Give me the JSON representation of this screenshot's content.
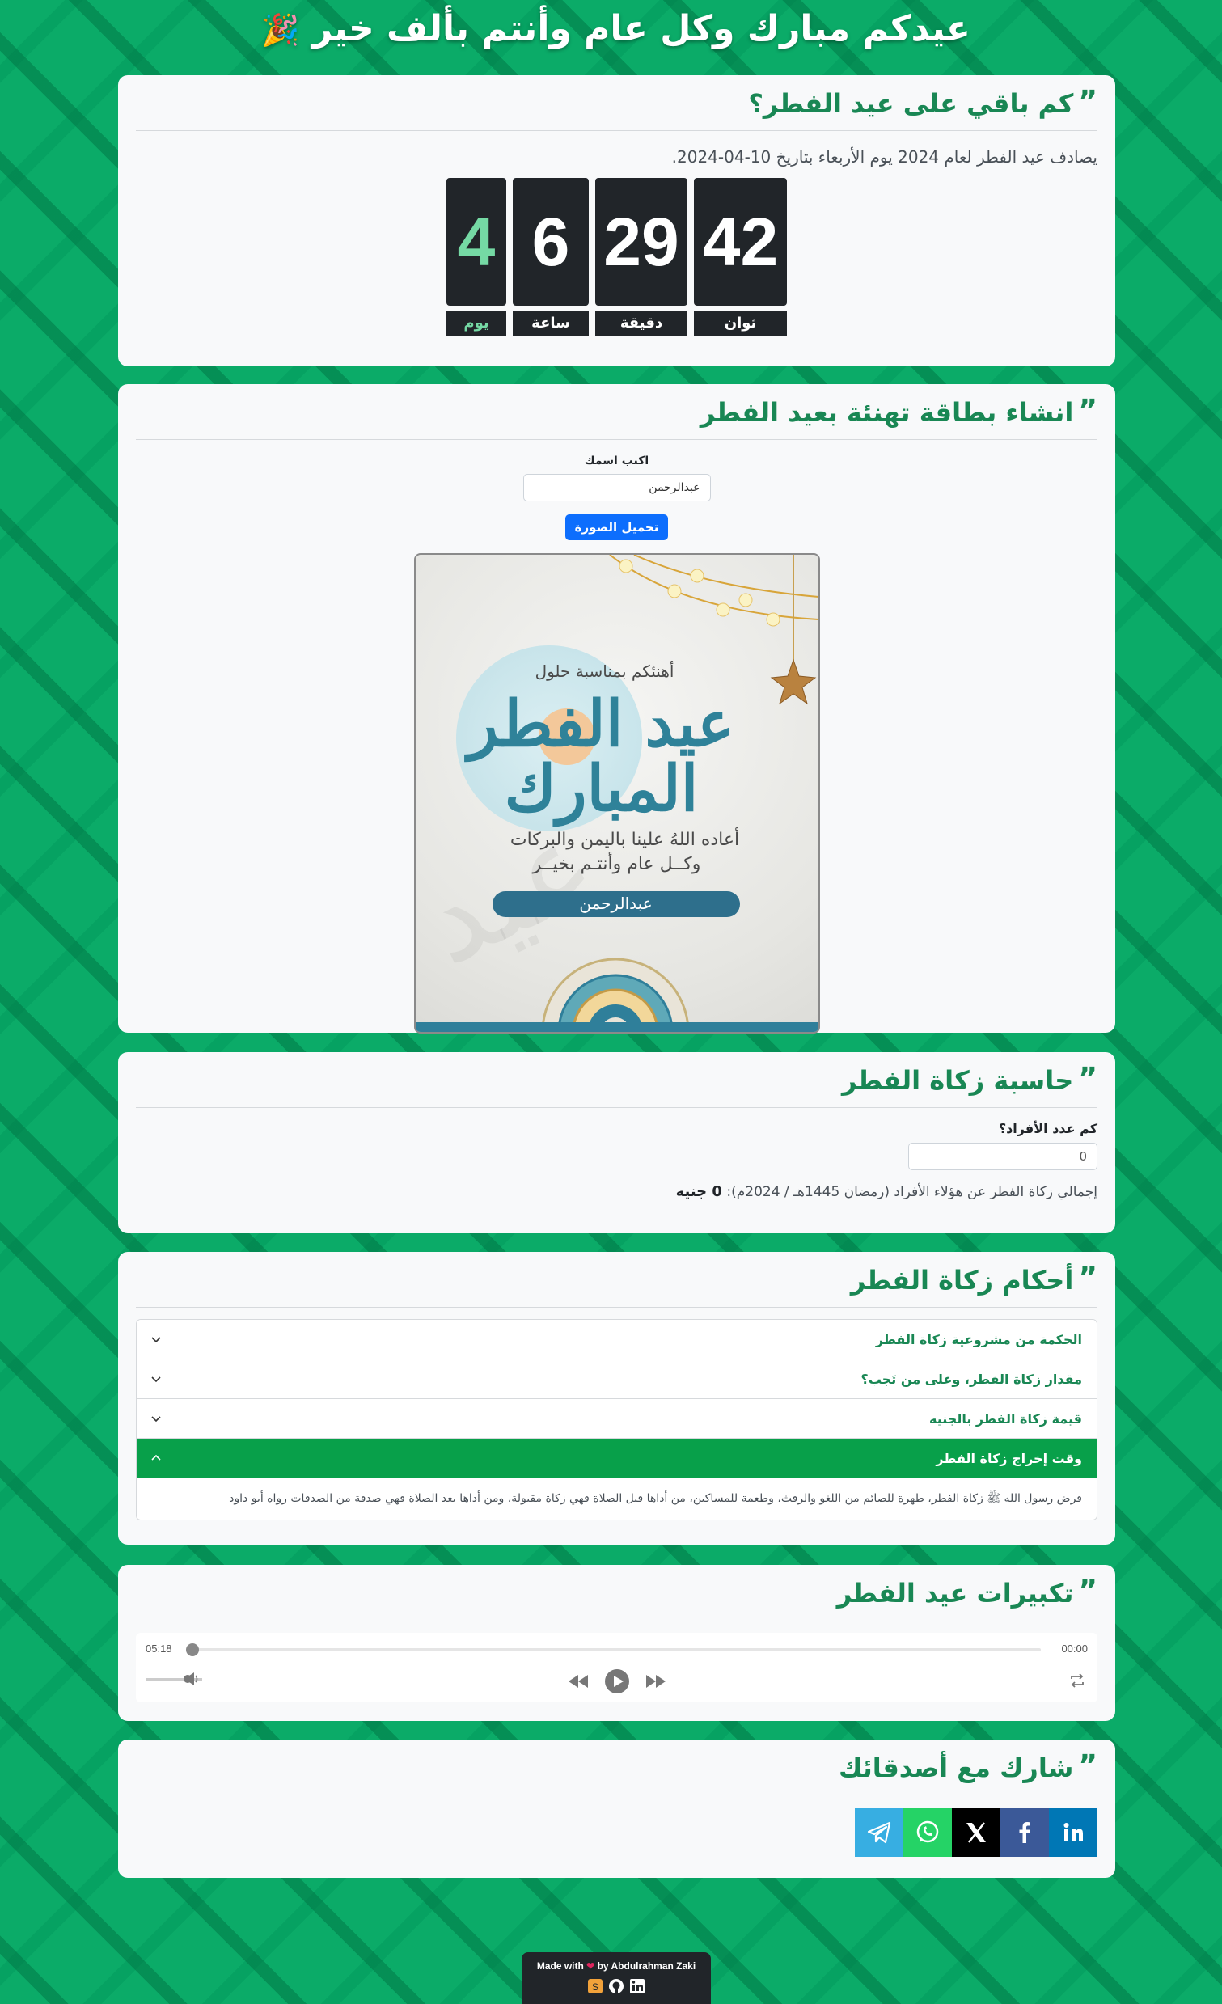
{
  "header": {
    "title": "عيدكم مبارك وكل عام وأنتم بألف خير",
    "emoji": "🎉"
  },
  "countdown": {
    "title": "كم باقي على عيد الفطر؟",
    "lead": "يصادف عيد الفطر لعام 2024 يوم الأربعاء بتاريخ 10-04-2024.",
    "days": "4",
    "days_label": "يوم",
    "hours": "6",
    "hours_label": "ساعة",
    "minutes": "29",
    "minutes_label": "دقيقة",
    "seconds": "42",
    "seconds_label": "ثوان"
  },
  "card_generator": {
    "title": "انشاء بطاقة تهنئة بعيد الفطر",
    "name_label": "اكتب اسمك",
    "name_value": "عبدالرحمن",
    "download_button": "تحميل الصورة",
    "card": {
      "intro": "أهنئكم بمناسبة حلول",
      "calligraphy": "عيد الفطر المبارك",
      "line1": "أعاده اللهُ علينا باليمن والبركات",
      "line2": "وكــل عام وأنتـم بخيــر",
      "name": "عبدالرحمن"
    }
  },
  "zakat_calc": {
    "title": "حاسبة زكاة الفطر",
    "question": "كم عدد الأفراد؟",
    "value": "0",
    "result_prefix": "إجمالي زكاة الفطر عن هؤلاء الأفراد (رمضان 1445هـ / 2024م):",
    "result_value": "0 جنيه"
  },
  "zakat_rules": {
    "title": "أحكام زكاة الفطر",
    "items": [
      {
        "label": "الحكمة من مشروعية زكاة الفطر"
      },
      {
        "label": "مقدار زكاة الفطر، وعلى من تَجب؟"
      },
      {
        "label": "قيمة زكاة الفطر بالجنيه"
      },
      {
        "label": "وقت إخراج زكاة الفطر"
      }
    ],
    "open_body": "فرض رسول الله ﷺ زكاة الفطر، طهرة للصائم من اللغو والرفث، وطعمة للمساكين، من أداها قبل الصلاة فهي زكاة مقبولة، ومن أداها بعد الصلاة فهي صدقة من الصدقات رواه أبو داود"
  },
  "takbeerat": {
    "title": "تكبيرات عيد الفطر",
    "current_time": "00:00",
    "duration": "05:18",
    "progress": 0
  },
  "share": {
    "title": "شارك مع أصدقائك",
    "buttons": [
      {
        "name": "telegram",
        "color": "#37aee2"
      },
      {
        "name": "whatsapp",
        "color": "#25d366"
      },
      {
        "name": "x",
        "color": "#000000"
      },
      {
        "name": "facebook",
        "color": "#3b5998"
      },
      {
        "name": "linkedin",
        "color": "#0077b5"
      }
    ]
  },
  "footer": {
    "made_with": "Made with",
    "by": "by Abdulrahman Zaki"
  },
  "colors": {
    "brand_green": "#198754",
    "active_green": "#08a04a",
    "primary_blue": "#0d6efd",
    "page_bg": "#0bab68"
  }
}
